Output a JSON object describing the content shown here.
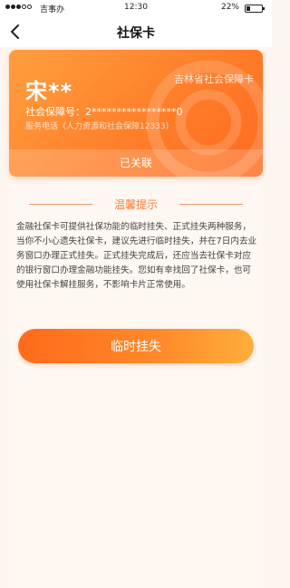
{
  "status_bar": {
    "carrier": "吉事办",
    "time": "12:30",
    "battery_percent": "22%",
    "battery_level": 0.22,
    "signal_bars_filled": 3,
    "signal_bars_total": 5
  },
  "nav": {
    "title": "社保卡",
    "back_icon": "chevron-left-icon"
  },
  "card": {
    "holder_name": "宋**",
    "province": "吉林省社会保障卡",
    "number_label": "社会保障号：",
    "number_value": "2*****************0",
    "service_phone": "服务电话（人力资源和社会保障12333）",
    "status": "已关联",
    "gradient_start": "#ff9f3f",
    "gradient_end": "#ff6a1f"
  },
  "tips": {
    "title": "温馨提示",
    "body": "金融社保卡可提供社保功能的临时挂失、正式挂失两种服务，当你不小心遗失社保卡，建议先进行临时挂失，并在7日内去业务窗口办理正式挂失。正式挂失完成后，还应当去社保卡对应的银行窗口办理金融功能挂失。您如有幸找回了社保卡，也可使用社保卡解挂服务，不影响卡片正常使用。",
    "accent_color": "#ff7a2e"
  },
  "actions": {
    "temporary_report_loss": "临时挂失"
  }
}
